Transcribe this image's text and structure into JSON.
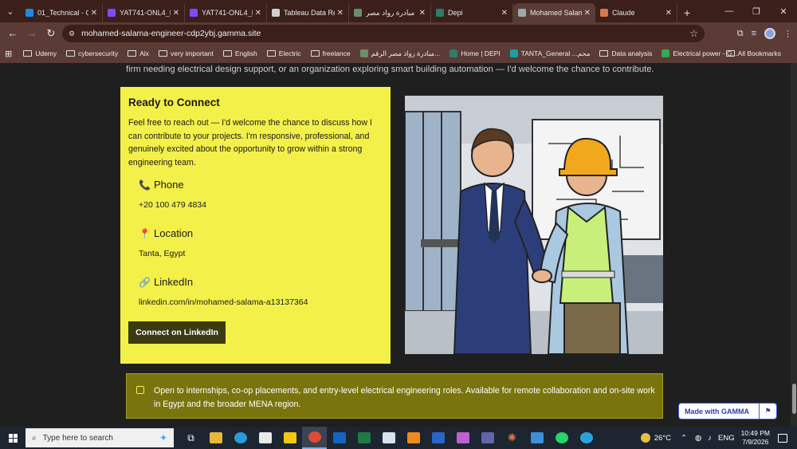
{
  "tabs": [
    {
      "title": "01_Technical - O",
      "color": "#1e88e5"
    },
    {
      "title": "YAT741-ONL4_D",
      "color": "#7c4dff"
    },
    {
      "title": "YAT741-ONL4_D",
      "color": "#7c4dff"
    },
    {
      "title": "Tableau Data Re",
      "color": "#cfcfcf"
    },
    {
      "title": "مبادرة رواد مصر",
      "color": "#6b8e6b"
    },
    {
      "title": "Depi",
      "color": "#2e7d6a"
    },
    {
      "title": "Mohamed Salam",
      "color": "#9aa",
      "active": true
    },
    {
      "title": "Claude",
      "color": "#d9774b"
    }
  ],
  "toolbar": {
    "url": "mohamed-salama-engineer-cdp2ybj.gamma.site"
  },
  "bookmarks": [
    {
      "label": "Udemy",
      "type": "folder"
    },
    {
      "label": "cybersecurity",
      "type": "folder"
    },
    {
      "label": "Alx",
      "type": "folder"
    },
    {
      "label": "very important",
      "type": "folder"
    },
    {
      "label": "English",
      "type": "folder"
    },
    {
      "label": "Electric",
      "type": "folder"
    },
    {
      "label": "freelance",
      "type": "folder"
    },
    {
      "label": "مبادرة رواد مصر الرقم...",
      "type": "site",
      "color": "#6b8e6b"
    },
    {
      "label": "Home | DEPI",
      "type": "site",
      "color": "#2e7d6a"
    },
    {
      "label": "TANTA_General ...محم",
      "type": "site",
      "color": "#1aa0a0"
    },
    {
      "label": "Data analysis",
      "type": "folder"
    },
    {
      "label": "Electrical power - G...",
      "type": "site",
      "color": "#34a853"
    }
  ],
  "all_bookmarks_label": "All Bookmarks",
  "page": {
    "intro": "firm needing electrical design support, or an organization exploring smart building automation — I'd welcome the chance to contribute.",
    "card": {
      "title": "Ready to Connect",
      "lead": "Feel free to reach out — I'd welcome the chance to discuss how I can contribute to your projects. I'm responsive, professional, and genuinely excited about the opportunity to grow within a strong engineering team.",
      "phone_label": "Phone",
      "phone_icon": "📞",
      "phone_value": "+20 100 479 4834",
      "location_label": "Location",
      "location_icon": "📍",
      "location_value": "Tanta, Egypt",
      "linkedin_label": "LinkedIn",
      "linkedin_icon": "🔗",
      "linkedin_value": "linkedin.com/in/mohamed-salama-a13137364",
      "button_label": "Connect on LinkedIn"
    },
    "note": "Open to internships, co-op placements, and entry-level electrical engineering roles. Available for remote collaboration and on-site work in Egypt and the broader MENA region.",
    "gamma_badge": "Made with GAMMA"
  },
  "taskbar": {
    "search_placeholder": "Type here to search",
    "temperature": "26°C",
    "language": "ENG",
    "time": "10:49 PM",
    "date": "7/9/2026"
  }
}
